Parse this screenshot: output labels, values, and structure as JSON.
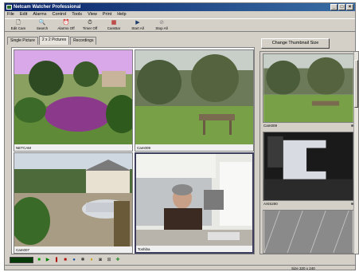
{
  "window": {
    "title": "Netcam Watcher Professional",
    "minimize": "_",
    "maximize": "□",
    "close": "×"
  },
  "menu": [
    "File",
    "Edit",
    "Alarms",
    "Control",
    "Tools",
    "View",
    "Print",
    "Help"
  ],
  "toolbar": {
    "buttons": [
      {
        "label": "Edit Cam",
        "icon": "document-icon",
        "glyph": "🗋"
      },
      {
        "label": "Search",
        "icon": "magnifier-icon",
        "glyph": "🔍"
      },
      {
        "label": "Alarms Off",
        "icon": "alarm-icon",
        "glyph": "⏰"
      },
      {
        "label": "Timer Off",
        "icon": "timer-icon",
        "glyph": "⏱"
      },
      {
        "label": "CamBar",
        "icon": "cambar-icon",
        "glyph": "▦"
      },
      {
        "label": "Start All",
        "icon": "start-all-icon",
        "glyph": "▶"
      },
      {
        "label": "Stop All",
        "icon": "stop-all-icon",
        "glyph": "⊘"
      }
    ]
  },
  "tabs": [
    {
      "label": "Single Picture",
      "active": false
    },
    {
      "label": "2 x 2 Pictures",
      "active": true
    },
    {
      "label": "Recordings",
      "active": false
    }
  ],
  "cameras": [
    {
      "label": "NETCAM"
    },
    {
      "label": "Cam009"
    },
    {
      "label": "Cam007"
    },
    {
      "label": "Toshiba"
    }
  ],
  "side": {
    "button_label": "Change Thumbnail Size",
    "thumbnails": [
      {
        "label": "Cam009"
      },
      {
        "label": "AXIS200"
      },
      {
        "label": ""
      }
    ]
  },
  "bottombar": {
    "icons": [
      "record-icon",
      "play-icon",
      "pause-icon",
      "stop-icon",
      "globe-icon",
      "bug-icon",
      "light-icon",
      "snapshot-icon",
      "grid-icon",
      "motion-icon"
    ]
  },
  "status": {
    "size": "Size 320 x 240"
  },
  "colors": {
    "title_start": "#0a246a",
    "title_end": "#3a6ea5",
    "chrome": "#d4d0c8",
    "led": "#073b07"
  }
}
